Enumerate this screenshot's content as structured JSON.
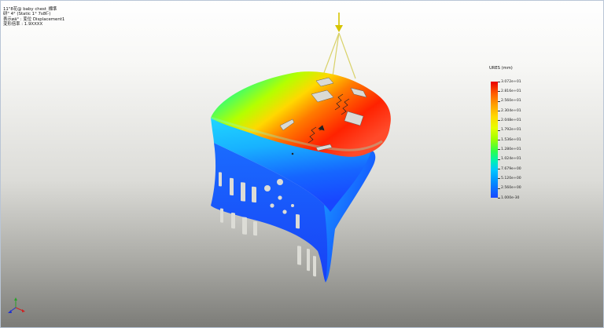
{
  "info": {
    "line1": "11\"8花@ baby chest_標準",
    "line2": "研\" 4° (Static 1° 7s8t-)",
    "line3": "表示øä° : 変位 Displacement1",
    "line4": "変形倍率 : 1.9XXXX"
  },
  "legend": {
    "title": "URES (mm)",
    "labels": [
      "3.072e+01",
      "2.816e+01",
      "2.560e+01",
      "2.304e+01",
      "2.048e+01",
      "1.792e+01",
      "1.536e+01",
      "1.280e+01",
      "1.024e+01",
      "7.679e+00",
      "5.120e+00",
      "2.560e+00",
      "1.000e-30"
    ],
    "colors": {
      "max": "#e80000",
      "mid": "#2cff4a",
      "min": "#1846ff"
    }
  },
  "icons": {
    "load_arrow": "load-arrow-icon",
    "triad": "axis-triad-icon"
  }
}
